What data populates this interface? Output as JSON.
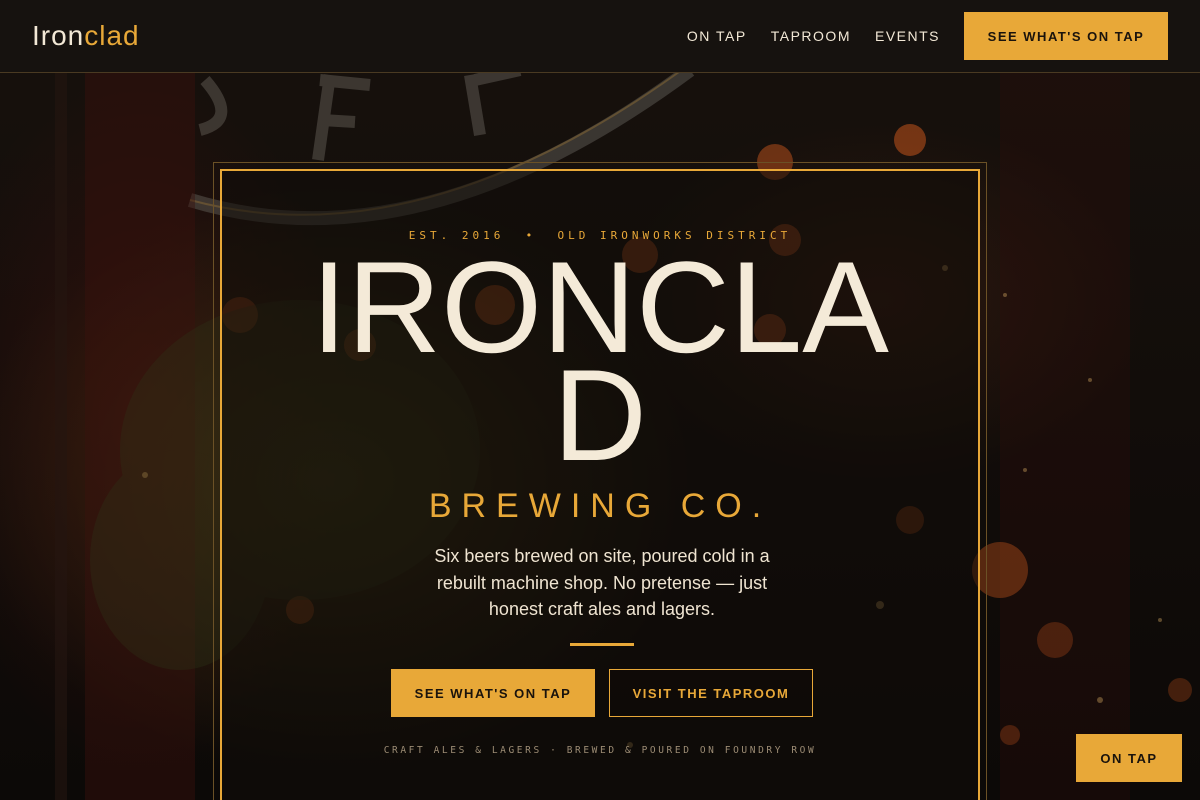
{
  "colors": {
    "accent": "#e8a838",
    "background": "#0e0b09",
    "text": "#f2e8d6"
  },
  "nav": {
    "brand_main": "Iron",
    "brand_accent": "clad",
    "links": [
      "ON TAP",
      "TAPROOM",
      "EVENTS"
    ],
    "cta_label": "SEE WHAT'S ON TAP"
  },
  "hero": {
    "eyebrow": "EST. 2016  •  OLD IRONWORKS DISTRICT",
    "title_line1": "IRONCLA",
    "title_line2": "D",
    "subtitle": "BREWING CO.",
    "description": "Six beers brewed on site, poured cold in a rebuilt machine shop. No pretense — just honest craft ales and lagers.",
    "primary_button": "SEE WHAT'S ON TAP",
    "secondary_button": "VISIT THE TAPROOM",
    "footline": "CRAFT ALES & LAGERS · BREWED & POURED ON FOUNDRY ROW"
  },
  "floating_button": "ON TAP"
}
